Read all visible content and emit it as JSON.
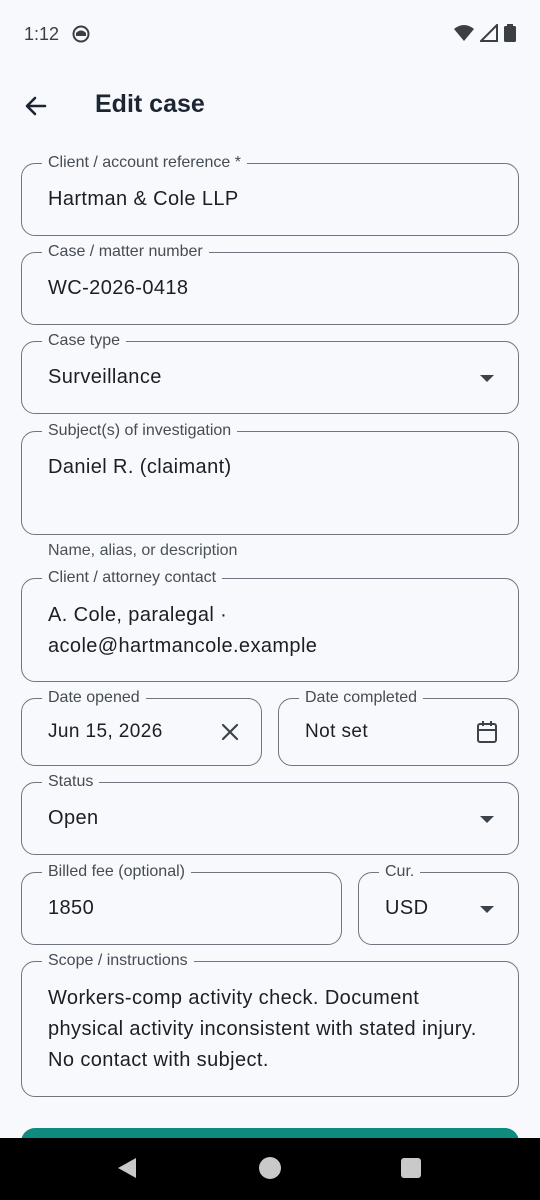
{
  "status_bar": {
    "time": "1:12"
  },
  "app_bar": {
    "title": "Edit case"
  },
  "form": {
    "client_ref": {
      "label": "Client / account reference *",
      "value": "Hartman & Cole LLP"
    },
    "case_number": {
      "label": "Case / matter number",
      "value": "WC-2026-0418"
    },
    "case_type": {
      "label": "Case type",
      "value": "Surveillance"
    },
    "subjects": {
      "label": "Subject(s) of investigation",
      "value": "Daniel R. (claimant)",
      "helper": "Name, alias, or description"
    },
    "contact": {
      "label": "Client / attorney contact",
      "value": "A. Cole, paralegal · acole@hartmancole.example"
    },
    "date_opened": {
      "label": "Date opened",
      "value": "Jun 15, 2026"
    },
    "date_completed": {
      "label": "Date completed",
      "value": "Not set"
    },
    "status": {
      "label": "Status",
      "value": "Open"
    },
    "billed_fee": {
      "label": "Billed fee (optional)",
      "value": "1850"
    },
    "currency": {
      "label": "Cur.",
      "value": "USD"
    },
    "scope": {
      "label": "Scope / instructions",
      "value": "Workers-comp activity check. Document physical activity inconsistent with stated injury. No contact with subject."
    }
  },
  "icons": {
    "back": "arrow-left-icon",
    "clear": "close-icon",
    "calendar": "calendar-icon",
    "dropdown": "chevron-down-icon"
  },
  "colors": {
    "accent": "#0f8a7e",
    "outline": "#6f7680",
    "background": "#f7f9fc"
  }
}
